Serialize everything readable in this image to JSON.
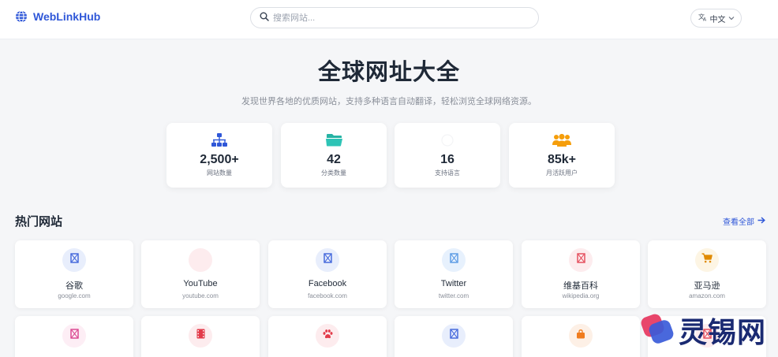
{
  "header": {
    "logo_text": "WebLinkHub",
    "search_placeholder": "搜索网站...",
    "language": "中文"
  },
  "hero": {
    "title": "全球网址大全",
    "subtitle": "发现世界各地的优质网站，支持多种语言自动翻译，轻松浏览全球网络资源。"
  },
  "stats": [
    {
      "value": "2,500+",
      "label": "网站数量",
      "icon": "sitemap-icon",
      "color": "#2f57d8"
    },
    {
      "value": "42",
      "label": "分类数量",
      "icon": "folder-icon",
      "color": "#2ec4b6"
    },
    {
      "value": "16",
      "label": "支持语言",
      "icon": "language-icon",
      "color": "#9ca3af"
    },
    {
      "value": "85k+",
      "label": "月活跃用户",
      "icon": "users-icon",
      "color": "#f59e0b"
    }
  ],
  "section": {
    "title": "热门网站",
    "view_all": "查看全部"
  },
  "sites": [
    {
      "name": "谷歌",
      "domain": "google.com",
      "icon": "broken-image-icon",
      "bg": "#e8eefc",
      "color": "#2f57d8"
    },
    {
      "name": "YouTube",
      "domain": "youtube.com",
      "icon": "blank-icon",
      "bg": "#fdecee",
      "color": "#fdecee"
    },
    {
      "name": "Facebook",
      "domain": "facebook.com",
      "icon": "broken-image-icon",
      "bg": "#e8eefc",
      "color": "#2f57d8"
    },
    {
      "name": "Twitter",
      "domain": "twitter.com",
      "icon": "broken-image-icon",
      "bg": "#e7f1fd",
      "color": "#4a90e2"
    },
    {
      "name": "维基百科",
      "domain": "wikipedia.org",
      "icon": "broken-image-icon",
      "bg": "#fdecee",
      "color": "#e23b4a"
    },
    {
      "name": "亚马逊",
      "domain": "amazon.com",
      "icon": "cart-icon",
      "bg": "#fdf5e4",
      "color": "#e08a00"
    }
  ],
  "sites_row2": [
    {
      "icon": "broken-image-icon",
      "bg": "#fdeef5",
      "color": "#d63384"
    },
    {
      "icon": "film-icon",
      "bg": "#fdecee",
      "color": "#e23b4a"
    },
    {
      "icon": "paw-icon",
      "bg": "#fdecee",
      "color": "#e23b4a"
    },
    {
      "icon": "broken-image-icon",
      "bg": "#e8eefc",
      "color": "#2f57d8"
    },
    {
      "icon": "bag-icon",
      "bg": "#fdf0e6",
      "color": "#f07c1e"
    },
    {
      "icon": "broken-image-icon",
      "bg": "#fdecee",
      "color": "#e23b4a"
    }
  ],
  "watermark": {
    "text": "灵锡网"
  }
}
